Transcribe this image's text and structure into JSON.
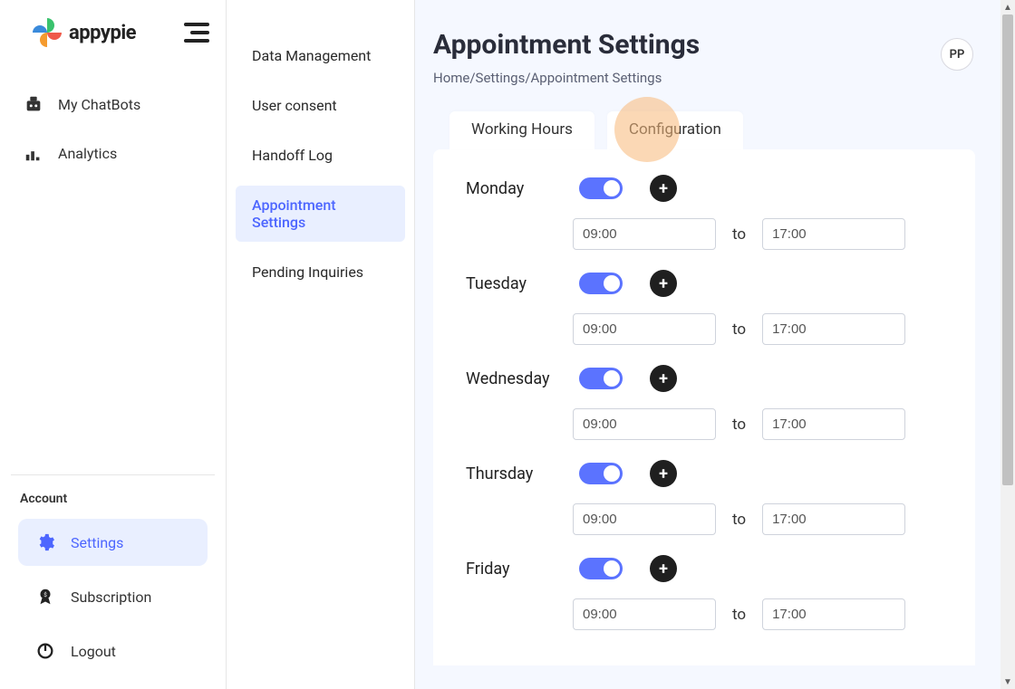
{
  "brand": {
    "name": "appypie"
  },
  "nav": {
    "items": [
      {
        "label": "My ChatBots",
        "icon": "robot-icon"
      },
      {
        "label": "Analytics",
        "icon": "bar-chart-icon"
      }
    ]
  },
  "account": {
    "heading": "Account",
    "items": [
      {
        "label": "Settings",
        "icon": "gear-icon",
        "active": true
      },
      {
        "label": "Subscription",
        "icon": "medal-icon",
        "active": false
      },
      {
        "label": "Logout",
        "icon": "power-icon",
        "active": false
      }
    ]
  },
  "sub_nav": {
    "items": [
      {
        "label": "Data Management",
        "active": false
      },
      {
        "label": "User consent",
        "active": false
      },
      {
        "label": "Handoff Log",
        "active": false
      },
      {
        "label": "Appointment Settings",
        "active": true
      },
      {
        "label": "Pending Inquiries",
        "active": false
      }
    ]
  },
  "header": {
    "title": "Appointment Settings",
    "breadcrumb": "Home/Settings/Appointment Settings",
    "avatar_initials": "PP"
  },
  "tabs": [
    {
      "label": "Working Hours",
      "active": true
    },
    {
      "label": "Configuration",
      "active": false
    }
  ],
  "highlight": {
    "target": "tab-configuration"
  },
  "days": [
    {
      "name": "Monday",
      "enabled": true,
      "from": "09:00",
      "to_label": "to",
      "to": "17:00"
    },
    {
      "name": "Tuesday",
      "enabled": true,
      "from": "09:00",
      "to_label": "to",
      "to": "17:00"
    },
    {
      "name": "Wednesday",
      "enabled": true,
      "from": "09:00",
      "to_label": "to",
      "to": "17:00"
    },
    {
      "name": "Thursday",
      "enabled": true,
      "from": "09:00",
      "to_label": "to",
      "to": "17:00"
    },
    {
      "name": "Friday",
      "enabled": true,
      "from": "09:00",
      "to_label": "to",
      "to": "17:00"
    }
  ],
  "plus_glyph": "+"
}
